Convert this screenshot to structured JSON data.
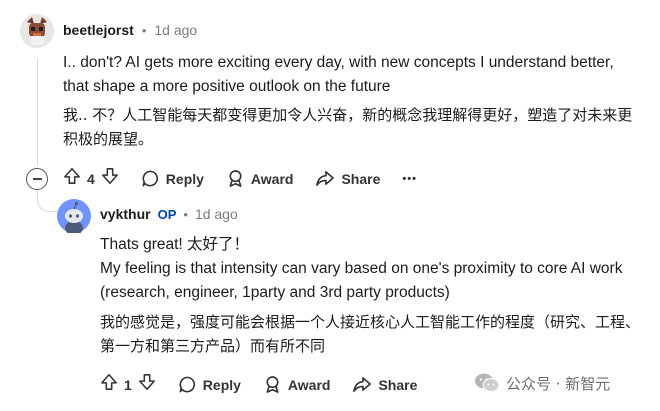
{
  "comment1": {
    "username": "beetlejorst",
    "time": "1d ago",
    "text_en": "I.. don't? AI gets more exciting every day, with new concepts I understand better, that shape a more positive outlook on the future",
    "text_zh": "我.. 不？人工智能每天都变得更加令人兴奋，新的概念我理解得更好，塑造了对未来更积极的展望。",
    "votes": "4",
    "reply_label": "Reply",
    "award_label": "Award",
    "share_label": "Share",
    "more_label": "•••"
  },
  "comment2": {
    "username": "vykthur",
    "op_badge": "OP",
    "time": "1d ago",
    "line1": "Thats great!  太好了！",
    "line2_en": "My feeling is that intensity can vary based on one's proximity to core AI work (research, engineer, 1party and 3rd party products)",
    "line2_zh": "我的感觉是，强度可能会根据一个人接近核心人工智能工作的程度（研究、工程、第一方和第三方产品）而有所不同",
    "votes": "1",
    "reply_label": "Reply",
    "award_label": "Award",
    "share_label": "Share"
  },
  "watermark": {
    "text": "公众号 · 新智元"
  },
  "colors": {
    "text": "#1c1c1c",
    "meta": "#7c7c7c",
    "op_badge": "#0045ac",
    "avatar2_bg": "#7193ff"
  }
}
